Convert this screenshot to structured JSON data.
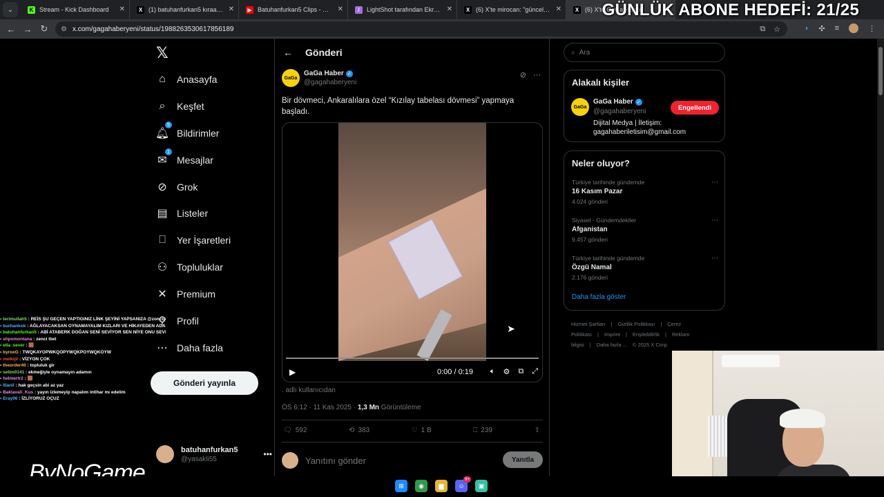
{
  "browser": {
    "tabs": [
      {
        "label": "Stream - Kick Dashboard",
        "icon": "kick-icon",
        "color": "#53fc18",
        "glyph": "K",
        "active": false
      },
      {
        "label": "(1) batuhanfurkan5 kıraathanesi",
        "icon": "x-icon",
        "color": "#000000",
        "glyph": "X",
        "active": false
      },
      {
        "label": "Batuhanfurkan5 Clips - YouTube",
        "icon": "youtube-icon",
        "color": "#ff0000",
        "glyph": "▶",
        "active": false
      },
      {
        "label": "LightShot tarafından Ekran Görüntüsü",
        "icon": "lightshot-icon",
        "color": "#a070e0",
        "glyph": "/",
        "active": false
      },
      {
        "label": "(6) X'te mirocan: \"güncel mizah",
        "icon": "x-icon",
        "color": "#000000",
        "glyph": "X",
        "active": false
      },
      {
        "label": "(6) X'te GaGa Haber",
        "icon": "x-icon",
        "color": "#000000",
        "glyph": "X",
        "active": true
      }
    ],
    "close_glyph": "✕",
    "url": "x.com/gagahaberyeni/status/1988263530617856189",
    "stream_goal": "GÜNLÜK ABONE HEDEFİ: 21/25"
  },
  "nav": {
    "logo": "𝕏",
    "items": [
      {
        "label": "Anasayfa",
        "icon": "home-icon",
        "glyph": "⌂",
        "badge": ""
      },
      {
        "label": "Keşfet",
        "icon": "search-icon",
        "glyph": "⌕",
        "badge": ""
      },
      {
        "label": "Bildirimler",
        "icon": "bell-icon",
        "glyph": "🔔︎",
        "badge": "5"
      },
      {
        "label": "Mesajlar",
        "icon": "mail-icon",
        "glyph": "✉",
        "badge": "1"
      },
      {
        "label": "Grok",
        "icon": "grok-icon",
        "glyph": "⊘",
        "badge": ""
      },
      {
        "label": "Listeler",
        "icon": "list-icon",
        "glyph": "▤",
        "badge": ""
      },
      {
        "label": "Yer İşaretleri",
        "icon": "bookmark-icon",
        "glyph": "⎕",
        "badge": ""
      },
      {
        "label": "Topluluklar",
        "icon": "communities-icon",
        "glyph": "⚇",
        "badge": ""
      },
      {
        "label": "Premium",
        "icon": "x-premium-icon",
        "glyph": "✕",
        "badge": ""
      },
      {
        "label": "Profil",
        "icon": "profile-icon",
        "glyph": "⚲",
        "badge": ""
      },
      {
        "label": "Daha fazla",
        "icon": "more-circle-icon",
        "glyph": "⋯",
        "badge": ""
      }
    ],
    "post_button": "Gönderi yayınla",
    "account": {
      "name": "batuhanfurkan5",
      "handle": "@yasakli55"
    }
  },
  "main": {
    "title": "Gönderi",
    "post": {
      "avatar_text": "GaGa",
      "author": "GaGa Haber",
      "handle": "@gagahaberyeni",
      "text": "Bir dövmeci, Ankaralılara özel “Kızılay tabelası dövmesi” yapmaya başladı.",
      "video_time": "0:00 / 0:19",
      "video_progress": 0,
      "source": ". adlı kullanıcıdan",
      "time": "ÖS 6:12 · 11 Kas 2025 · ",
      "views": "1,3 Mn",
      "views_label": " Görüntüleme",
      "stats": {
        "replies": "592",
        "reposts": "383",
        "likes": "1 B",
        "bookmarks": "239"
      }
    },
    "reply_placeholder": "Yanıtını gönder",
    "reply_button": "Yanıtla"
  },
  "sidebar": {
    "search_placeholder": "Ara",
    "related": {
      "title": "Alakalı kişiler",
      "name": "GaGa Haber",
      "handle": "@gagahaberyeni",
      "bio": "Dijital Medya | İletişim: gagahaberiletisim@gmail.com",
      "button": "Engellendi"
    },
    "trends": {
      "title": "Neler oluyor?",
      "items": [
        {
          "context": "Türkiye tarihinde gündemde",
          "name": "16 Kasım Pazar",
          "posts": "4.024 gönderi"
        },
        {
          "context": "Siyaset · Gündemdekiler",
          "name": "Afganistan",
          "posts": "9.457 gönderi"
        },
        {
          "context": "Türkiye tarihinde gündemde",
          "name": "Özgü Namal",
          "posts": "2.176 gönderi"
        }
      ],
      "show_more": "Daha fazla göster"
    },
    "footer": [
      "Hizmet Şartları",
      "|",
      "Gizlilik Politikası",
      "|",
      "Çerez Politikası",
      "|",
      "Imprint",
      "|",
      "Erişilebilirlik",
      "|",
      "Reklam bilgisi",
      "|",
      "Daha fazla ...",
      "© 2025 X Corp."
    ]
  },
  "stream": {
    "chat": [
      {
        "user": "terimullah5",
        "color": "#7fdc6a",
        "msg": "REİS ŞU GEÇEN YAPTIGINIZ LİNK ŞEYİNİ YAPSANIZA @zoncipenguen"
      },
      {
        "user": "burhankok",
        "color": "#4fb0ff",
        "msg": "AĞLAYACAKSAN OYNAMAYALIM KIZLARI VE HİKAYEDEN ADAMLARI İZLEYELİM"
      },
      {
        "user": "batuhanfurkan5",
        "color": "#53fc18",
        "msg": "ABİ ATABERK DOĞAN SENİ SEVİYOR SEN NİYE ONU SEVMİYON"
      },
      {
        "user": "shpxmontana",
        "color": "#e28bd8",
        "msg": "zenci tiwt"
      },
      {
        "user": "ella_sever",
        "color": "#53fc18",
        "msg": "🟫"
      },
      {
        "user": "byroxG",
        "color": "#f0c34a",
        "msg": "TWQKAYOPWKQOPYWQKPOYWQKOYW"
      },
      {
        "user": "melkijil",
        "color": "#e65050",
        "msg": "VİZYON ÇOK"
      },
      {
        "user": "theorder40",
        "color": "#ffb347",
        "msg": "topluluk gir"
      },
      {
        "user": "selim0141",
        "color": "#7fdc6a",
        "msg": "ekmeğiyle oynamayın adamın"
      },
      {
        "user": "helmertr2",
        "color": "#e28bd8",
        "msg": "🟫"
      },
      {
        "user": "lllanil",
        "color": "#4fb0ff",
        "msg": "hak geçsin abi az yaz"
      },
      {
        "user": "Baklavali_Kus",
        "color": "#e28bd8",
        "msg": "yayın izlemeyip napalım intihar mı edelim"
      },
      {
        "user": "Eray06",
        "color": "#4fb0ff",
        "msg": "İZLİYORUZ OÇUZ"
      }
    ],
    "brand": "ByNoGame"
  },
  "taskbar": {
    "apps": [
      {
        "name": "windows-start-icon",
        "glyph": "⊞",
        "color": "#1a8cff"
      },
      {
        "name": "chrome-icon",
        "glyph": "◉",
        "color": "#2e9b48"
      },
      {
        "name": "file-explorer-icon",
        "glyph": "▆",
        "color": "#e8b530"
      },
      {
        "name": "discord-icon",
        "glyph": "☺",
        "color": "#5865f2",
        "badge": "9+"
      },
      {
        "name": "streamlabs-icon",
        "glyph": "▣",
        "color": "#31c3a2"
      }
    ]
  }
}
